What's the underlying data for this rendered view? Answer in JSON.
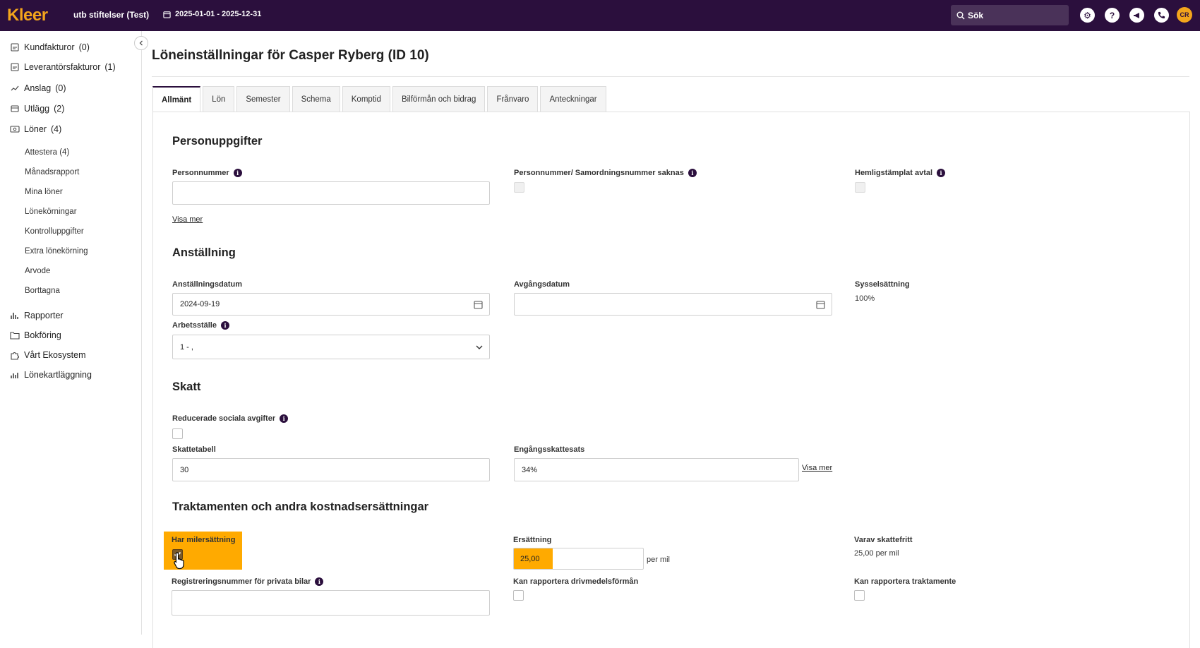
{
  "topbar": {
    "logo": "Kleer",
    "org": "utb stiftelser (Test)",
    "period": "2025-01-01 - 2025-12-31",
    "search_placeholder": "Sök",
    "icons": [
      "gear-icon",
      "help-icon",
      "megaphone-icon",
      "phone-icon"
    ],
    "avatar": "CR"
  },
  "sidebar": {
    "items": [
      {
        "label": "Kundfakturor",
        "count": "(0)",
        "icon": "invoice-icon"
      },
      {
        "label": "Leverantörsfakturor",
        "count": "(1)",
        "icon": "supplier-invoice-icon"
      },
      {
        "label": "Anslag",
        "count": "(0)",
        "icon": "grant-icon"
      },
      {
        "label": "Utlägg",
        "count": "(2)",
        "icon": "expense-icon"
      },
      {
        "label": "Löner",
        "count": "(4)",
        "icon": "salary-icon"
      }
    ],
    "sub_items": [
      "Attestera (4)",
      "Månadsrapport",
      "Mina löner",
      "Lönekörningar",
      "Kontrolluppgifter",
      "Extra lönekörning",
      "Arvode",
      "Borttagna"
    ],
    "bottom_items": [
      {
        "label": "Rapporter",
        "icon": "chart-icon"
      },
      {
        "label": "Bokföring",
        "icon": "folder-icon"
      },
      {
        "label": "Vårt Ekosystem",
        "icon": "puzzle-icon"
      },
      {
        "label": "Lönekartläggning",
        "icon": "bar-chart-icon"
      }
    ]
  },
  "page": {
    "title": "Löneinställningar för Casper Ryberg (ID 10)",
    "tabs": [
      "Allmänt",
      "Lön",
      "Semester",
      "Schema",
      "Komptid",
      "Bilförmån och bidrag",
      "Frånvaro",
      "Anteckningar"
    ],
    "active_tab": "Allmänt"
  },
  "personuppgifter": {
    "title": "Personuppgifter",
    "personnummer_label": "Personnummer",
    "personnummer_value": "",
    "saknas_label": "Personnummer/ Samordningsnummer saknas",
    "hemlig_label": "Hemligstämplat avtal",
    "visa_mer": "Visa mer"
  },
  "anstallning": {
    "title": "Anställning",
    "anst_datum_label": "Anställningsdatum",
    "anst_datum_value": "2024-09-19",
    "avgang_label": "Avgångsdatum",
    "avgang_value": "",
    "syss_label": "Sysselsättning",
    "syss_value": "100%",
    "arbetsstalle_label": "Arbetsställe",
    "arbetsstalle_value": "1 - ,"
  },
  "skatt": {
    "title": "Skatt",
    "reducerade_label": "Reducerade sociala avgifter",
    "skattetabell_label": "Skattetabell",
    "skattetabell_value": "30",
    "engangs_label": "Engångsskattesats",
    "engangs_value": "34%",
    "visa_mer": "Visa mer"
  },
  "traktamenten": {
    "title": "Traktamenten och andra kostnadsersättningar",
    "milers_label": "Har milersättning",
    "milers_checked": true,
    "ersattning_label": "Ersättning",
    "ersattning_value": "25,00",
    "per_mil": "per mil",
    "varav_label": "Varav skattefritt",
    "varav_value": "25,00 per mil",
    "regnr_label": "Registreringsnummer för privata bilar",
    "drivmedel_label": "Kan rapportera drivmedelsförmån",
    "traktamente_label": "Kan rapportera traktamente"
  }
}
